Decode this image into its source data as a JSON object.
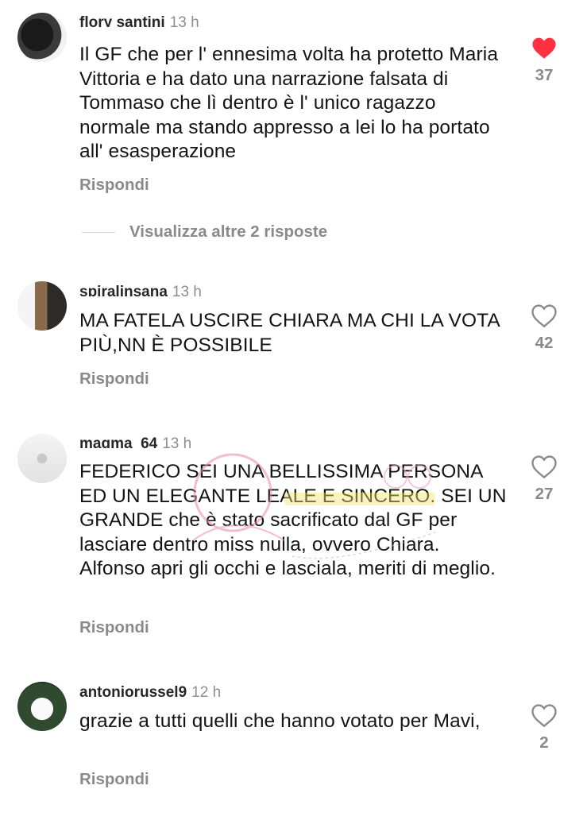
{
  "comments": [
    {
      "username": "flory santini",
      "time": "13 h",
      "text": "Il GF che per l' ennesima volta ha protetto Maria Vittoria e ha dato una narrazione falsata di Tommaso che lì dentro è l' unico ragazzo normale ma stando appresso a lei lo ha portato all' esasperazione",
      "reply_label": "Rispondi",
      "likes": "37",
      "liked": true,
      "view_replies": "Visualizza altre 2 risposte"
    },
    {
      "username": "spiralinsana",
      "time": "13 h",
      "text": "MA FATELA USCIRE CHIARA MA CHI LA VOTA PIÙ,NN È POSSIBILE",
      "reply_label": "Rispondi",
      "likes": "42",
      "liked": false
    },
    {
      "username": "magma_64",
      "time": "13 h",
      "text": "FEDERICO SEI UNA BELLISSIMA PERSONA ED UN ELEGANTE LEALE E SINCERO. SEI UN GRANDE che è stato sacrificato dal GF per lasciare dentro miss nulla, ovvero Chiara. Alfonso apri gli occhi e lasciala, meriti di meglio.",
      "reply_label": "Rispondi",
      "likes": "27",
      "liked": false
    },
    {
      "username": "antoniorussel9",
      "time": "12 h",
      "text": "grazie a tutti quelli che hanno votato per Mavi,",
      "reply_label": "Rispondi",
      "likes": "2",
      "liked": false
    }
  ],
  "colors": {
    "like_red": "#ff3040",
    "secondary_text": "#8a8a8a",
    "primary_text": "#141414"
  },
  "icons": {
    "liked": "heart-filled-icon",
    "unliked": "heart-outline-icon"
  }
}
